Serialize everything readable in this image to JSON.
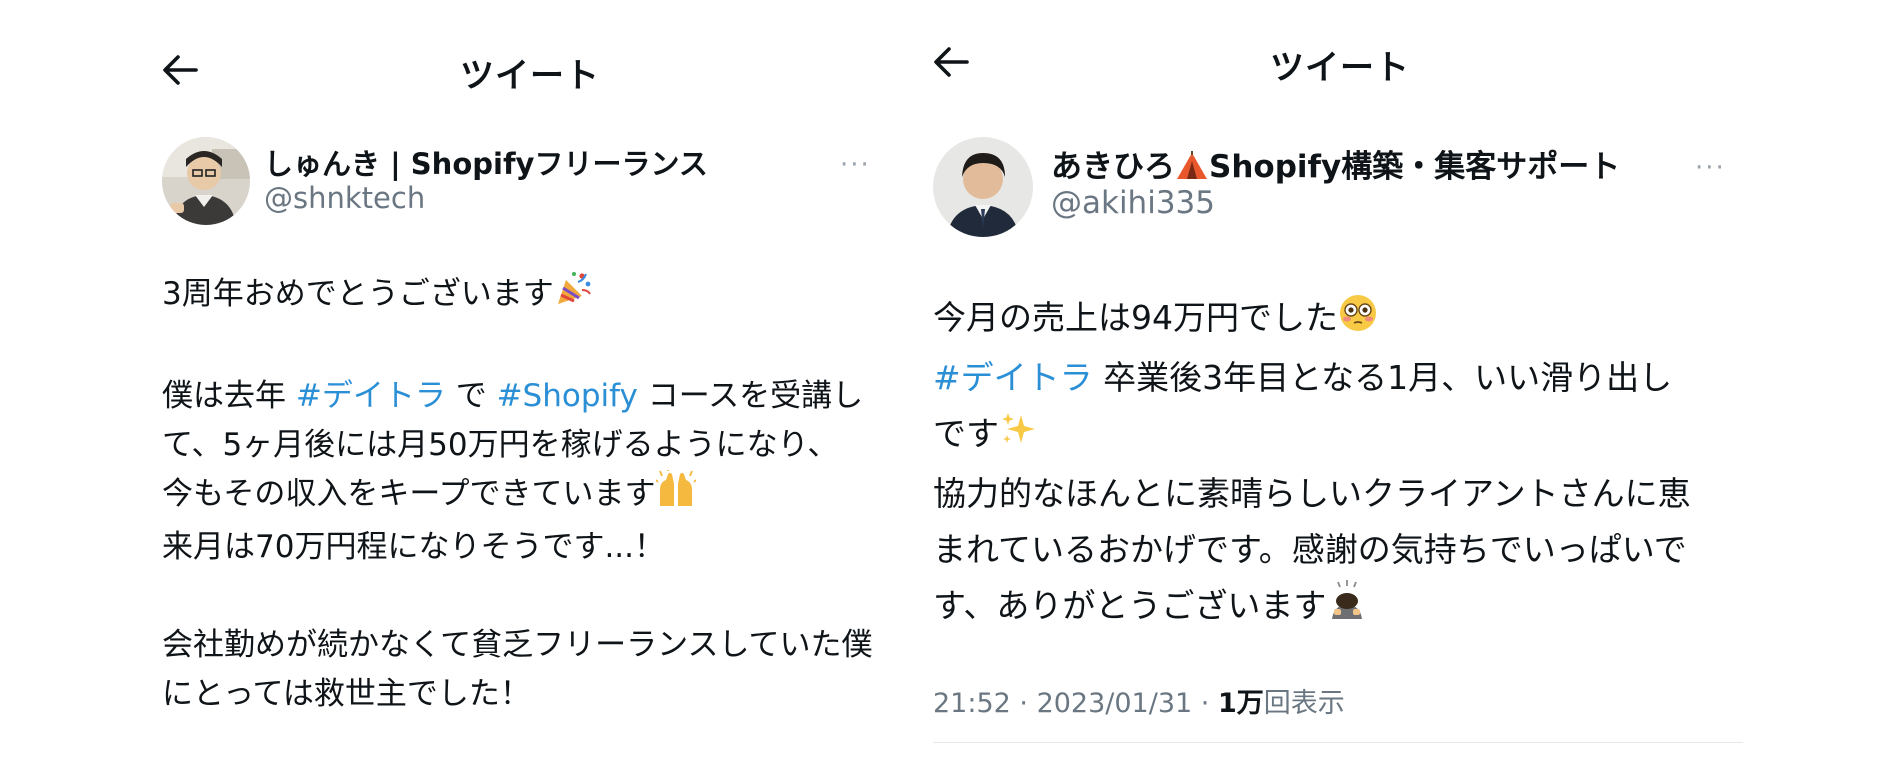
{
  "left_tweet": {
    "header_title": "ツイート",
    "display_name": "しゅんき | Shopifyフリーランス",
    "handle": "@shnktech",
    "more_label": "···",
    "lines": {
      "l1": "3周年おめでとうございます",
      "l2_a": "僕は去年 ",
      "l2_tag1": "#デイトラ",
      "l2_b": " で ",
      "l2_tag2": "#Shopify",
      "l2_c": " コースを受講し",
      "l3": "て、5ヶ月後には月50万円を稼げるようになり、",
      "l4": "今もその収入をキープできています",
      "l5": "来月は70万円程になりそうです...！",
      "l6": "会社勤めが続かなくて貧乏フリーランスしていた僕",
      "l7": "にとっては救世主でした！"
    },
    "emojis": [
      "party-popper",
      "raised-hands"
    ]
  },
  "right_tweet": {
    "header_title": "ツイート",
    "display_name_a": "あきひろ",
    "display_name_b": "Shopify構築・集客サポート",
    "handle": "@akihi335",
    "more_label": "···",
    "lines": {
      "l1": "今月の売上は94万円でした",
      "l2_tag": "#デイトラ",
      "l2_rest": " 卒業後3年目となる1月、いい滑り出し",
      "l3": "です",
      "l4": "協力的なほんとに素晴らしいクライアントさんに恵",
      "l5": "まれているおかげです。感謝の気持ちでいっぱいで",
      "l6": "す、ありがとうございます"
    },
    "emojis": [
      "tent",
      "flushed-face",
      "sparkles",
      "bowing-person"
    ],
    "meta": {
      "time": "21:52",
      "sep": " · ",
      "date": "2023/01/31",
      "views_count": "1万",
      "views_label": "回表示"
    }
  },
  "colors": {
    "hashtag": "#2b8fd6",
    "muted": "#6a7782",
    "text": "#0f1419"
  }
}
